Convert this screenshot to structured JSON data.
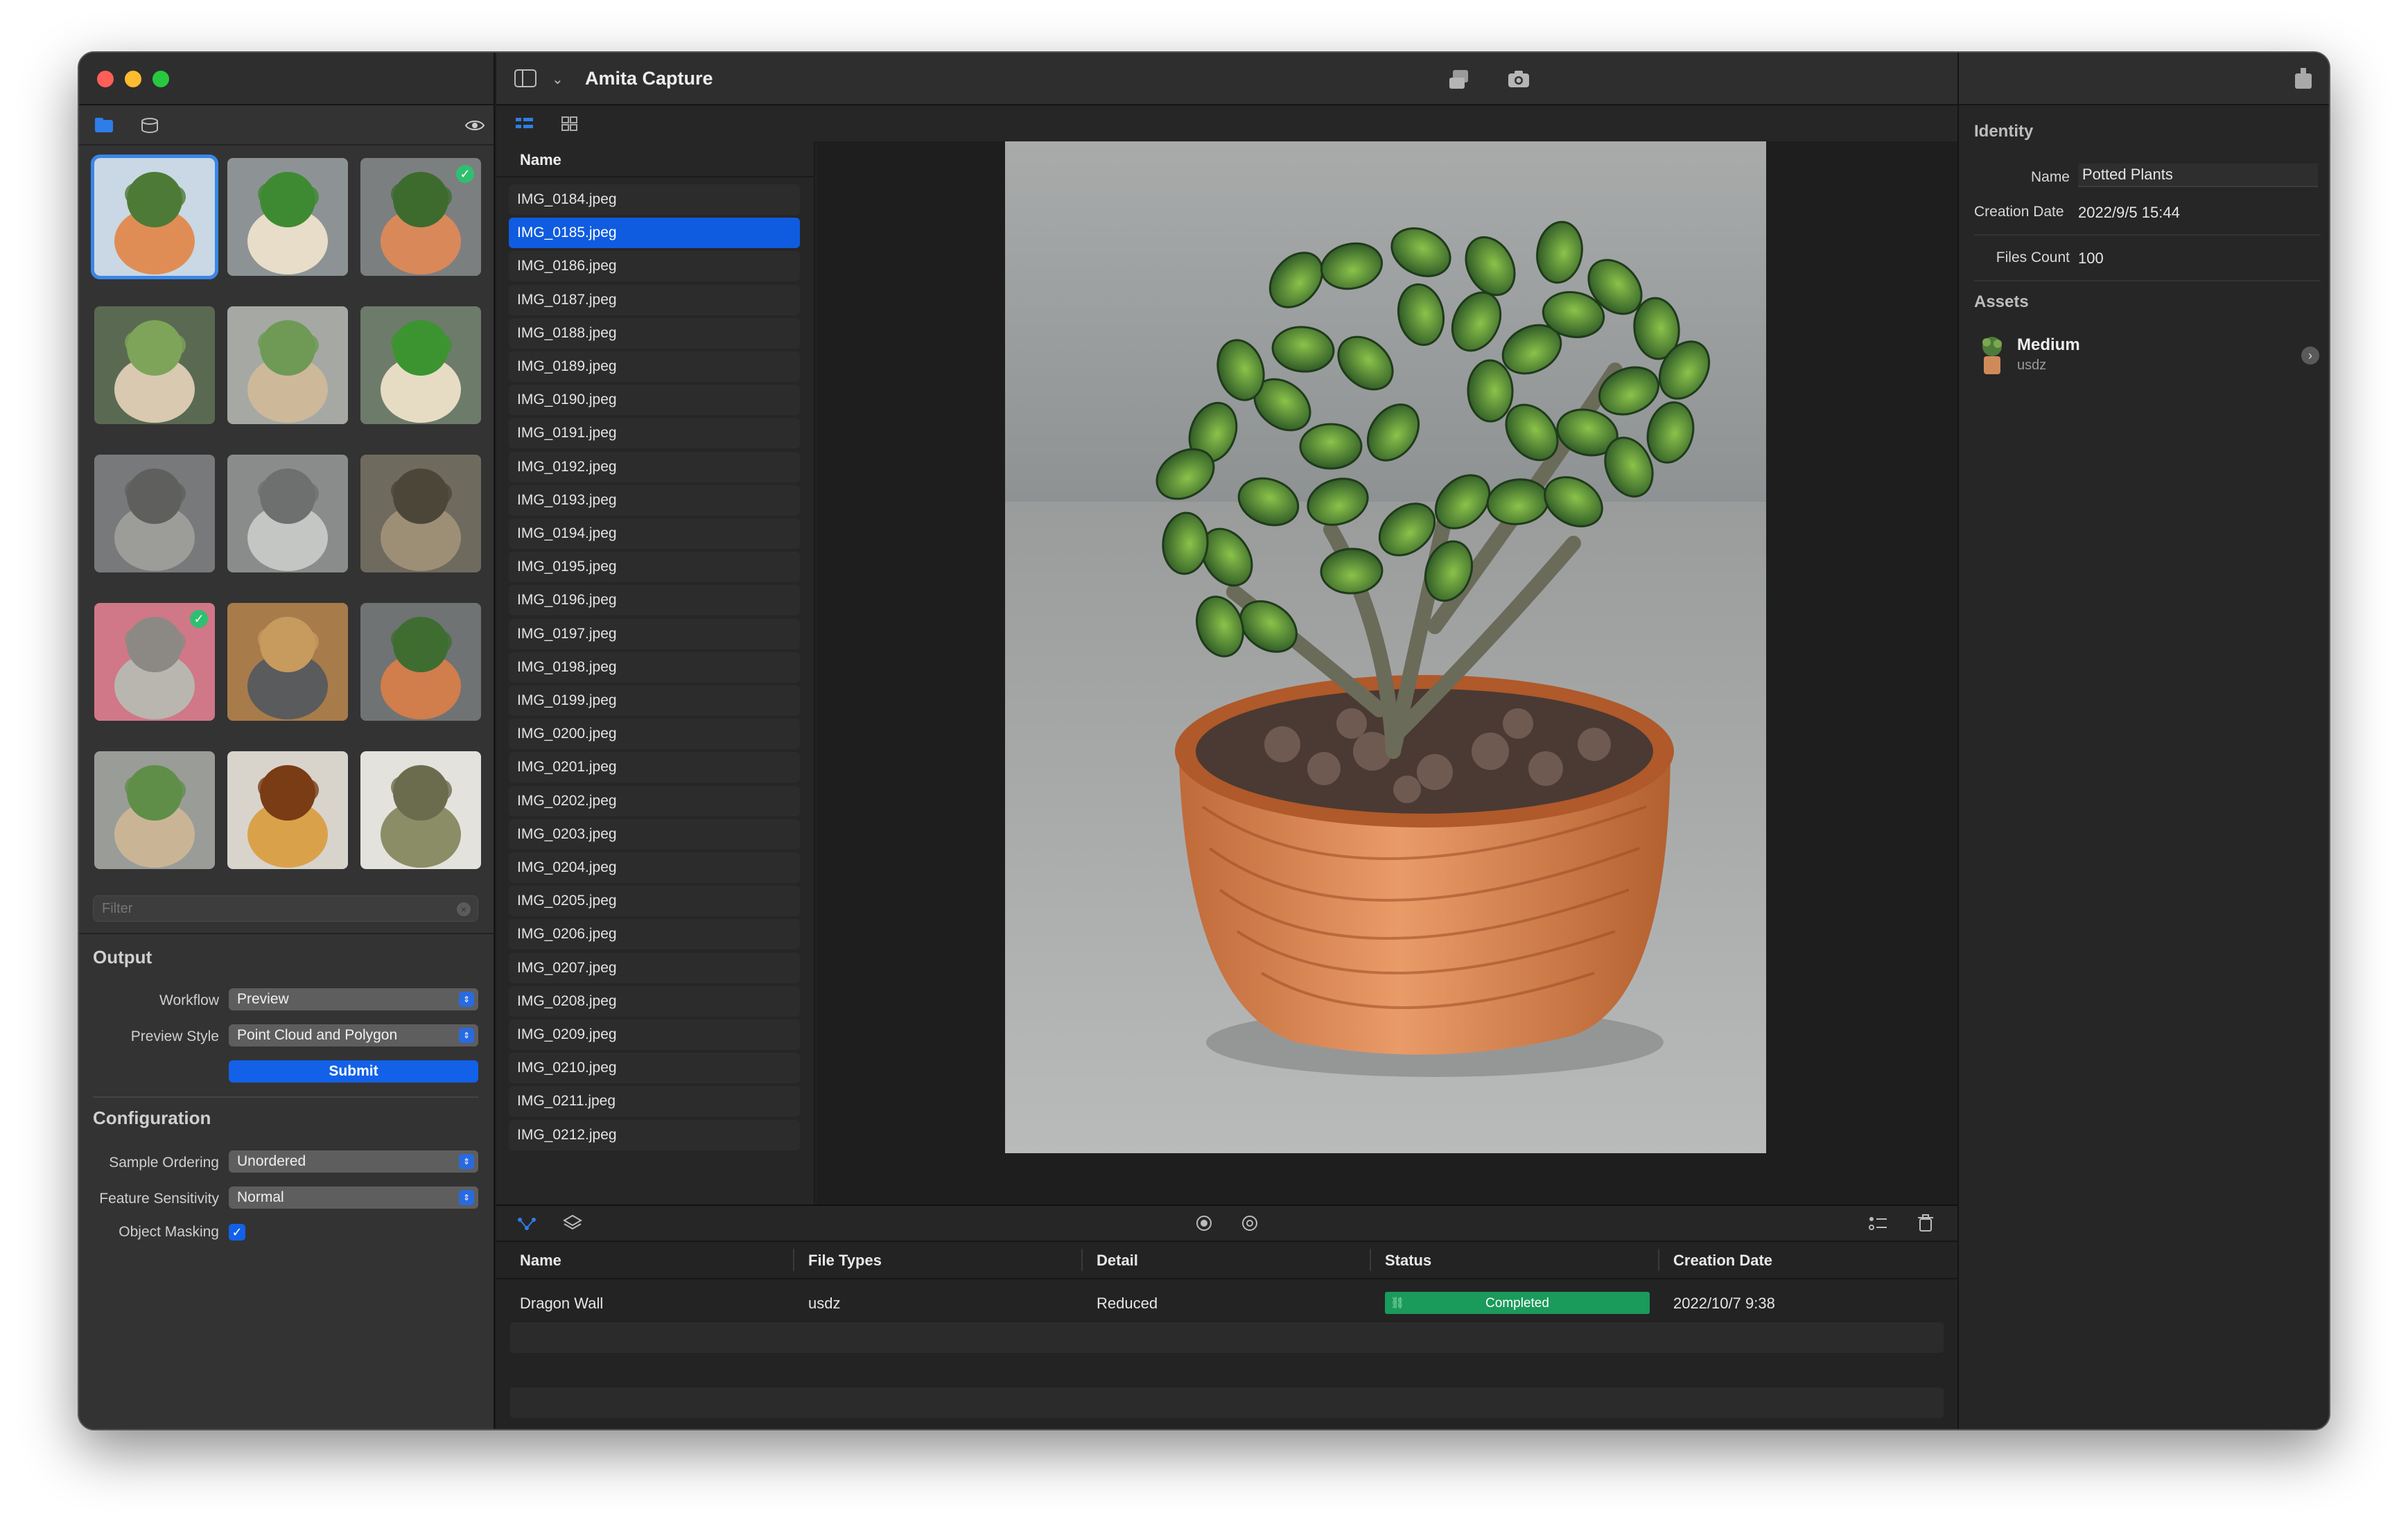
{
  "app": {
    "title": "Amita Capture"
  },
  "sidebar": {
    "filter_placeholder": "Filter",
    "thumbnails": [
      {
        "name": "potted-plant",
        "selected": true,
        "checked": false
      },
      {
        "name": "green-dragon-figure",
        "selected": false,
        "checked": false
      },
      {
        "name": "jade-plant-pot",
        "selected": false,
        "checked": true
      },
      {
        "name": "succulent-bowl",
        "selected": false,
        "checked": false
      },
      {
        "name": "wall-planter",
        "selected": false,
        "checked": false
      },
      {
        "name": "green-dragon-figure-2",
        "selected": false,
        "checked": false
      },
      {
        "name": "stone-guardian-statue",
        "selected": false,
        "checked": false
      },
      {
        "name": "metal-box",
        "selected": false,
        "checked": false
      },
      {
        "name": "stone-relief",
        "selected": false,
        "checked": false
      },
      {
        "name": "dragon-medallion",
        "selected": false,
        "checked": true
      },
      {
        "name": "wooden-lantern",
        "selected": false,
        "checked": false
      },
      {
        "name": "jade-plant-pot-2",
        "selected": false,
        "checked": false
      },
      {
        "name": "wall-planter-2",
        "selected": false,
        "checked": false
      },
      {
        "name": "bread-loaf",
        "selected": false,
        "checked": false
      },
      {
        "name": "ceramic-bowl",
        "selected": false,
        "checked": false
      }
    ],
    "output": {
      "title": "Output",
      "workflow_label": "Workflow",
      "workflow_value": "Preview",
      "preview_style_label": "Preview Style",
      "preview_style_value": "Point Cloud and Polygon",
      "submit_label": "Submit"
    },
    "configuration": {
      "title": "Configuration",
      "sample_ordering_label": "Sample Ordering",
      "sample_ordering_value": "Unordered",
      "feature_sensitivity_label": "Feature Sensitivity",
      "feature_sensitivity_value": "Normal",
      "object_masking_label": "Object Masking",
      "object_masking_checked": true
    }
  },
  "files": {
    "column_header": "Name",
    "selected_index": 1,
    "items": [
      "IMG_0184.jpeg",
      "IMG_0185.jpeg",
      "IMG_0186.jpeg",
      "IMG_0187.jpeg",
      "IMG_0188.jpeg",
      "IMG_0189.jpeg",
      "IMG_0190.jpeg",
      "IMG_0191.jpeg",
      "IMG_0192.jpeg",
      "IMG_0193.jpeg",
      "IMG_0194.jpeg",
      "IMG_0195.jpeg",
      "IMG_0196.jpeg",
      "IMG_0197.jpeg",
      "IMG_0198.jpeg",
      "IMG_0199.jpeg",
      "IMG_0200.jpeg",
      "IMG_0201.jpeg",
      "IMG_0202.jpeg",
      "IMG_0203.jpeg",
      "IMG_0204.jpeg",
      "IMG_0205.jpeg",
      "IMG_0206.jpeg",
      "IMG_0207.jpeg",
      "IMG_0208.jpeg",
      "IMG_0209.jpeg",
      "IMG_0210.jpeg",
      "IMG_0211.jpeg",
      "IMG_0212.jpeg"
    ]
  },
  "tasks": {
    "columns": [
      "Name",
      "File Types",
      "Detail",
      "Status",
      "Creation Date"
    ],
    "rows": [
      {
        "name": "Dragon Wall",
        "file_types": "usdz",
        "detail": "Reduced",
        "status": "Completed",
        "created": "2022/10/7 9:38",
        "progress": 1.0
      }
    ]
  },
  "inspector": {
    "identity_title": "Identity",
    "name_label": "Name",
    "name_value": "Potted Plants",
    "creation_date_label": "Creation Date",
    "creation_date_value": "2022/9/5 15:44",
    "files_count_label": "Files Count",
    "files_count_value": "100",
    "assets_title": "Assets",
    "asset": {
      "name": "Medium",
      "type": "usdz"
    }
  },
  "colors": {
    "accent": "#0f5ce0",
    "completed": "#1a9a5b",
    "check": "#2fbf71"
  }
}
